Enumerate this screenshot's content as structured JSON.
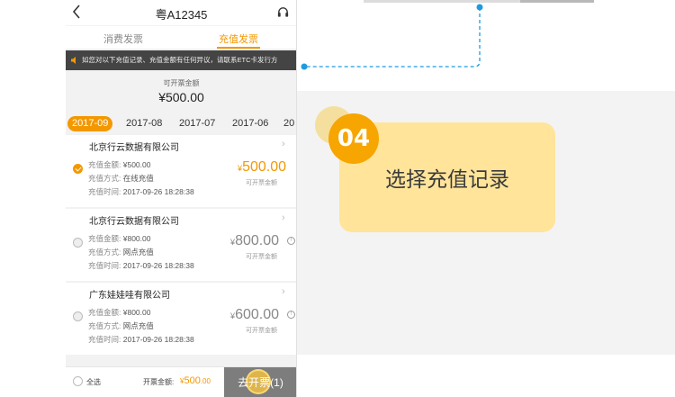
{
  "nav": {
    "title": "粤A12345"
  },
  "tabs": [
    {
      "label": "消费发票"
    },
    {
      "label": "充值发票"
    }
  ],
  "notice": "如您对以下充值记录、充值金额有任何异议，请联系ETC卡发行方",
  "invoice_amount": {
    "label": "可开票金额",
    "value": "¥500.00"
  },
  "months": [
    "2017-09",
    "2017-08",
    "2017-07",
    "2017-06",
    "20"
  ],
  "labels": {
    "amount": "充值金额:",
    "method": "充值方式:",
    "time": "充值时间:",
    "invoiceable": "可开票金额",
    "chevron": "›",
    "info": "!"
  },
  "records": [
    {
      "company": "北京行云数据有限公司",
      "amount": "¥500.00",
      "method": "在线充值",
      "time": "2017-09-26 18:28:38",
      "big_currency": "¥",
      "big_amount": "500.00",
      "selected": true
    },
    {
      "company": "北京行云数据有限公司",
      "amount": "¥800.00",
      "method": "网点充值",
      "time": "2017-09-26 18:28:38",
      "big_currency": "¥",
      "big_amount": "800.00",
      "selected": false
    },
    {
      "company": "广东娃娃哇有限公司",
      "amount": "¥800.00",
      "method": "网点充值",
      "time": "2017-09-26 18:28:38",
      "big_currency": "¥",
      "big_amount": "600.00",
      "selected": false
    }
  ],
  "bottom": {
    "select_all": "全选",
    "amount_label": "开票金额:",
    "amount_prefix": "¥",
    "amount_main": "500",
    "amount_cents": ".00",
    "button": "去开票(1)"
  },
  "step": {
    "number": "04",
    "label": "选择充值记录"
  },
  "colors": {
    "accent": "#f39800",
    "card": "#ffe49a",
    "badge": "#f7a500",
    "connector": "#1e9be0"
  },
  "icons": {
    "back": "chevron-left-icon",
    "support": "headset-icon",
    "notice": "speaker-icon"
  }
}
